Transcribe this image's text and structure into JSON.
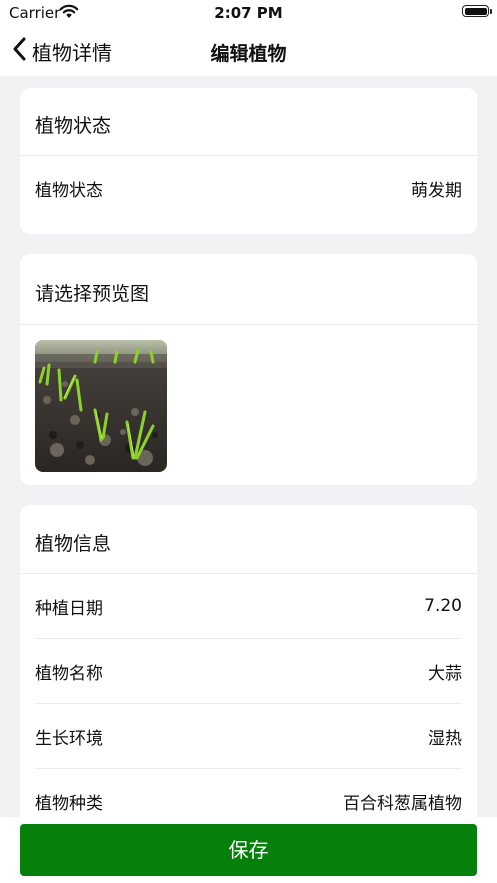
{
  "status_bar": {
    "carrier": "Carrier",
    "time": "2:07 PM"
  },
  "nav": {
    "back_label": "植物详情",
    "title": "编辑植物"
  },
  "status_card": {
    "header": "植物状态",
    "rows": [
      {
        "label": "植物状态",
        "value": "萌发期"
      }
    ]
  },
  "preview_card": {
    "header": "请选择预览图",
    "image_subject": "sprouting seedlings in soil"
  },
  "info_card": {
    "header": "植物信息",
    "rows": [
      {
        "label": "种植日期",
        "value": "7.20"
      },
      {
        "label": "植物名称",
        "value": "大蒜"
      },
      {
        "label": "生长环境",
        "value": "湿热"
      },
      {
        "label": "植物种类",
        "value": "百合科葱属植物"
      }
    ]
  },
  "footer": {
    "save_label": "保存"
  },
  "colors": {
    "accent_green": "#05800a",
    "background": "#f2f2f4"
  }
}
